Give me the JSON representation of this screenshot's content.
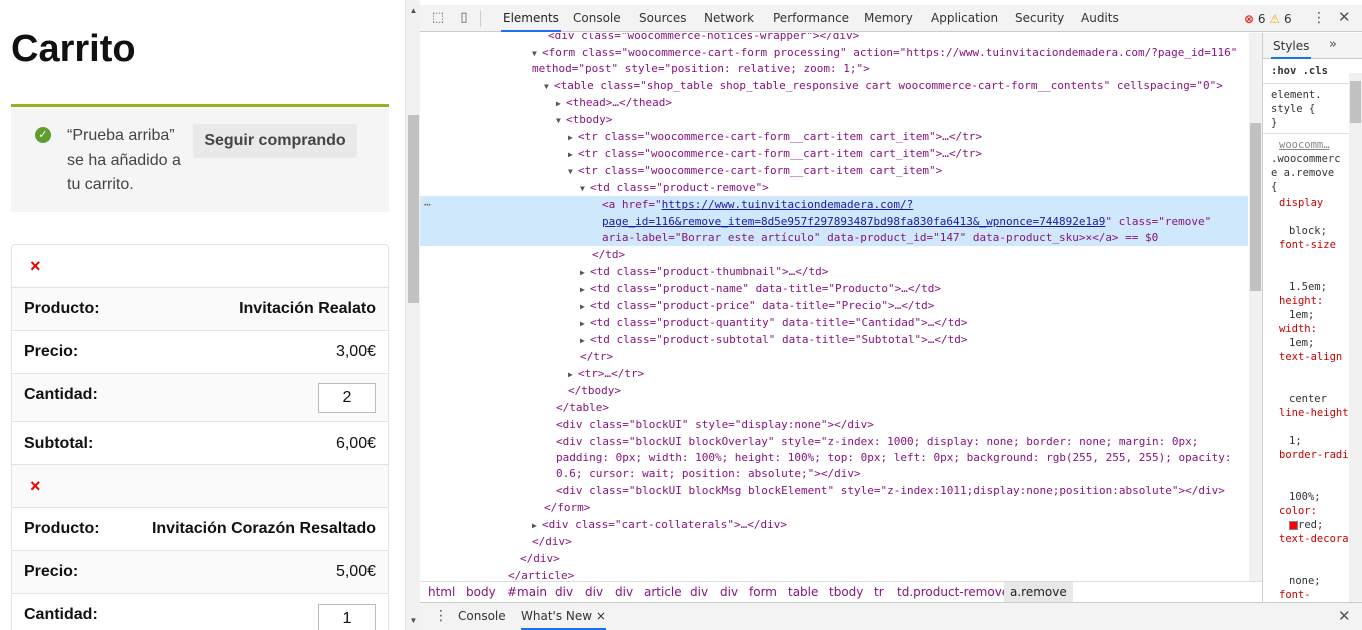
{
  "page": {
    "title": "Carrito",
    "notice": {
      "message": "“Prueba arriba” se ha añadido a tu carrito.",
      "continue_label": "Seguir comprando"
    },
    "remove_symbol": "×",
    "items": [
      {
        "product_label": "Producto:",
        "product": "Invitación Realato",
        "price_label": "Precio:",
        "price": "3,00€",
        "qty_label": "Cantidad:",
        "qty": "2",
        "subtotal_label": "Subtotal:",
        "subtotal": "6,00€"
      },
      {
        "product_label": "Producto:",
        "product": "Invitación Corazón Resaltado",
        "price_label": "Precio:",
        "price": "5,00€",
        "qty_label": "Cantidad:",
        "qty": "1"
      }
    ]
  },
  "devtools": {
    "tabs": [
      "Elements",
      "Console",
      "Sources",
      "Network",
      "Performance",
      "Memory",
      "Application",
      "Security",
      "Audits"
    ],
    "active_tab": "Elements",
    "errors": "6",
    "warnings": "6",
    "breadcrumbs": [
      "html",
      "body",
      "#main",
      "div",
      "div",
      "div",
      "article",
      "div",
      "div",
      "form",
      "table",
      "tbody",
      "tr",
      "td.product-remove",
      "a.remove"
    ],
    "styles_tabs": {
      "styles": "Styles",
      "more": "»"
    },
    "styles_filter": ":hov  .cls",
    "drawer_tabs": [
      "Console",
      "What's New"
    ],
    "drawer_close": "×",
    "dom": {
      "l01": "<div class=\"woocommerce-notices-wrapper\"></div>",
      "l02a": "<form class=\"woocommerce-cart-form processing\" action=\"https://www.tuinvitaciondemadera.com/?page_id=116\"",
      "l02b": "method=\"post\" style=\"position: relative; zoom: 1;\">",
      "l03": "<table class=\"shop_table shop_table_responsive cart woocommerce-cart-form__contents\" cellspacing=\"0\">",
      "l04": "<thead>…</thead>",
      "l05": "<tbody>",
      "l06": "<tr class=\"woocommerce-cart-form__cart-item cart_item\">…</tr>",
      "l07": "<tr class=\"woocommerce-cart-form__cart-item cart_item\">…</tr>",
      "l08": "<tr class=\"woocommerce-cart-form__cart-item cart_item\">",
      "l09": "<td class=\"product-remove\">",
      "l10_tag": "<a href=\"",
      "l10_url1": "https://www.tuinvitaciondemadera.com/?",
      "l10_url2": "page_id=116&remove_item=8d5e957f297893487bd98fa830fa6413&_wpnonce=744892e1a9",
      "l10_rest": "\" class=\"remove\"",
      "l10c": "aria-label=\"Borrar este artículo\" data-product_id=\"147\" data-product_sku>×</a> == $0",
      "l11": "</td>",
      "l12": "<td class=\"product-thumbnail\">…</td>",
      "l13": "<td class=\"product-name\" data-title=\"Producto\">…</td>",
      "l14": "<td class=\"product-price\" data-title=\"Precio\">…</td>",
      "l15": "<td class=\"product-quantity\" data-title=\"Cantidad\">…</td>",
      "l16": "<td class=\"product-subtotal\" data-title=\"Subtotal\">…</td>",
      "l17": "</tr>",
      "l18": "<tr>…</tr>",
      "l19": "</tbody>",
      "l20": "</table>",
      "l21": "<div class=\"blockUI\" style=\"display:none\"></div>",
      "l22a": "<div class=\"blockUI blockOverlay\" style=\"z-index: 1000; display: none; border: none; margin: 0px;",
      "l22b": "padding: 0px; width: 100%; height: 100%; top: 0px; left: 0px; background: rgb(255, 255, 255); opacity:",
      "l22c": "0.6; cursor: wait; position: absolute;\"></div>",
      "l23": "<div class=\"blockUI blockMsg blockElement\" style=\"z-index:1011;display:none;position:absolute\"></div>",
      "l24": "</form>",
      "l25": "<div class=\"cart-collaterals\">…</div>",
      "l26": "</div>",
      "l27": "</div>",
      "l28": "</article>"
    },
    "styles_rules": {
      "element_style": "element.",
      "element_style2": "style {",
      "close": "}",
      "source": "woocomm…",
      "selector1": ".woocommerc",
      "selector2": "e a.remove",
      "open": "{",
      "props": [
        {
          "name": "display",
          "value": "block;"
        },
        {
          "name": "font-size",
          "value": "1.5em;"
        },
        {
          "name": "height:",
          "value": "1em;"
        },
        {
          "name": "width:",
          "value": "1em;"
        },
        {
          "name": "text-align",
          "value": "center"
        },
        {
          "name": "line-height",
          "value": "1;"
        },
        {
          "name": "border-radius",
          "value": "100%;"
        },
        {
          "name": "color:",
          "value": "red;"
        },
        {
          "name": "text-decoration",
          "value": "none;"
        },
        {
          "name": "font-",
          "value": ""
        }
      ]
    }
  }
}
